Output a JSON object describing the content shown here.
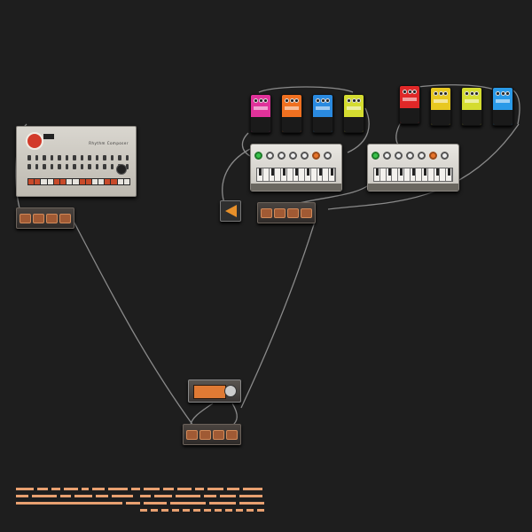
{
  "workspace": {
    "background": "#1e1e1e",
    "cable_color": "#8a8a8a"
  },
  "devices": {
    "drum_machine": {
      "model_text": "Rhythm Composer"
    },
    "synth_1": {
      "type": "bass-synth"
    },
    "synth_2": {
      "type": "bass-synth"
    },
    "pedals": [
      {
        "color": "#e0329a"
      },
      {
        "color": "#f07020"
      },
      {
        "color": "#2a8ae0"
      },
      {
        "color": "#d4dc30"
      },
      {
        "color": "#e02828"
      },
      {
        "color": "#e8c820"
      },
      {
        "color": "#d4dc30"
      },
      {
        "color": "#2a9ae8"
      }
    ]
  }
}
